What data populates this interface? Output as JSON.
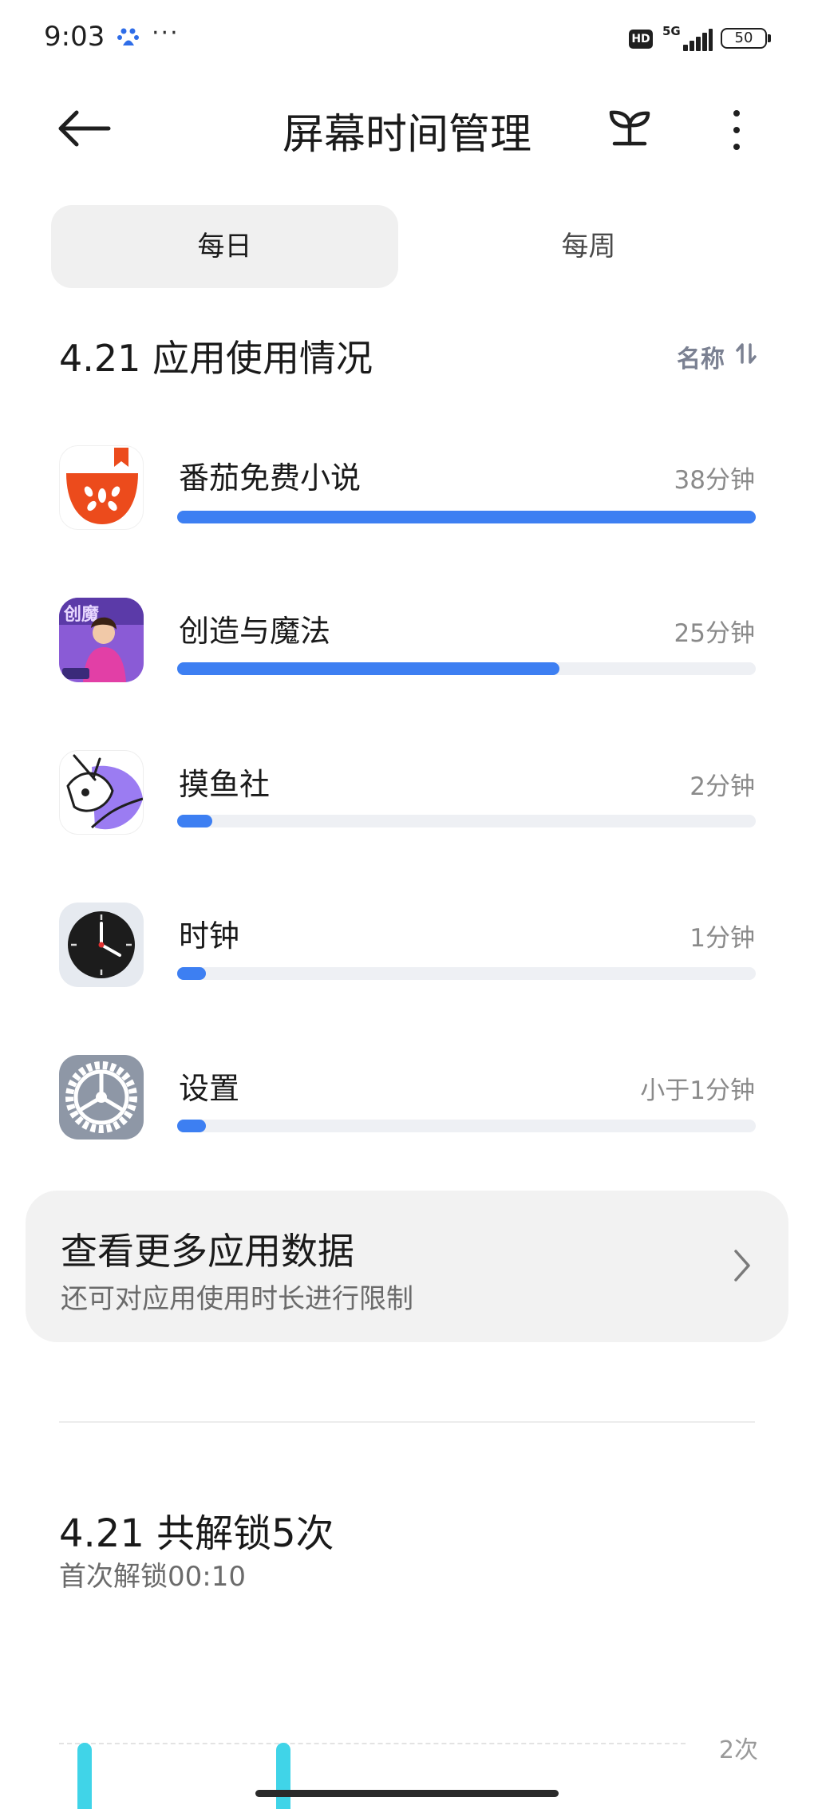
{
  "status_bar": {
    "time": "9:03",
    "dots": "···",
    "hd": "HD",
    "network": "5G",
    "battery": "50"
  },
  "header": {
    "title": "屏幕时间管理",
    "back_icon": "back-arrow-icon",
    "sprout_icon": "sprout-icon",
    "more_icon": "more-vertical-icon"
  },
  "tabs": [
    {
      "label": "每日",
      "selected": true
    },
    {
      "label": "每周",
      "selected": false
    }
  ],
  "usage": {
    "title": "4.21 应用使用情况",
    "sort_label": "名称",
    "sort_icon": "sort-icon",
    "accent_color": "#3d7ff2",
    "apps": [
      {
        "name": "番茄免费小说",
        "duration": "38分钟",
        "usage_fraction": 1.0,
        "icon": "tomato-novel-icon"
      },
      {
        "name": "创造与魔法",
        "duration": "25分钟",
        "usage_fraction": 0.66,
        "icon": "creation-magic-icon"
      },
      {
        "name": "摸鱼社",
        "duration": "2分钟",
        "usage_fraction": 0.06,
        "icon": "moyu-fish-icon"
      },
      {
        "name": "时钟",
        "duration": "1分钟",
        "usage_fraction": 0.05,
        "icon": "clock-icon"
      },
      {
        "name": "设置",
        "duration": "小于1分钟",
        "usage_fraction": 0.05,
        "icon": "settings-gear-icon"
      }
    ]
  },
  "more_card": {
    "title": "查看更多应用数据",
    "subtitle": "还可对应用使用时长进行限制"
  },
  "unlock": {
    "title": "4.21 共解锁5次",
    "subtitle": "首次解锁00:10",
    "axis_label": "2次",
    "bar_color": "#40d4e8"
  }
}
